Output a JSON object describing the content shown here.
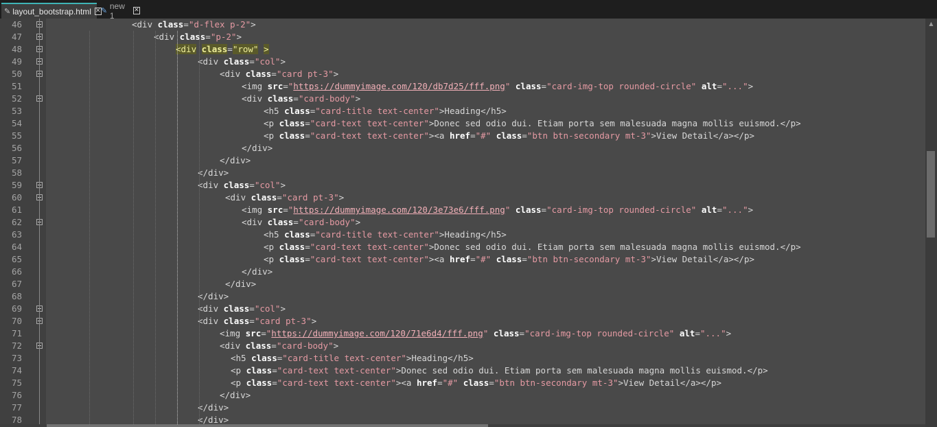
{
  "tabs": [
    {
      "label": "layout_bootstrap.html",
      "active": true,
      "icon": "pencil-icon"
    },
    {
      "label": "new 1",
      "active": false,
      "icon": "pencil-icon"
    }
  ],
  "colors": {
    "tab_accent": "#3fb4b6",
    "attr_value": "#e59aa3",
    "attr_name": "#ffffff",
    "tag": "#d8d8d8",
    "bracket_highlight": "#5a5a2a"
  },
  "lines": [
    {
      "n": "46",
      "fold": true,
      "indent": 8,
      "tokens": [
        [
          "t",
          "<div "
        ],
        [
          "a",
          "class"
        ],
        [
          "e",
          "="
        ],
        [
          "v",
          "\"d-flex p-2\""
        ],
        [
          "t",
          ">"
        ]
      ]
    },
    {
      "n": "47",
      "fold": true,
      "indent": 12,
      "tokens": [
        [
          "t",
          "<div "
        ],
        [
          "a",
          "class"
        ],
        [
          "e",
          "="
        ],
        [
          "v",
          "\"p-2\""
        ],
        [
          "t",
          ">"
        ]
      ]
    },
    {
      "n": "48",
      "fold": true,
      "indent": 16,
      "tokens": [
        [
          "h",
          "<div"
        ],
        [
          "t",
          " "
        ],
        [
          "ah",
          "class"
        ],
        [
          "e",
          "="
        ],
        [
          "vh",
          "\"row\""
        ],
        [
          "t",
          " "
        ],
        [
          "h",
          ">"
        ]
      ]
    },
    {
      "n": "49",
      "fold": true,
      "indent": 20,
      "tokens": [
        [
          "t",
          "<div "
        ],
        [
          "a",
          "class"
        ],
        [
          "e",
          "="
        ],
        [
          "v",
          "\"col\""
        ],
        [
          "t",
          ">"
        ]
      ]
    },
    {
      "n": "50",
      "fold": true,
      "indent": 24,
      "tokens": [
        [
          "t",
          "<div "
        ],
        [
          "a",
          "class"
        ],
        [
          "e",
          "="
        ],
        [
          "v",
          "\"card pt-3\""
        ],
        [
          "t",
          ">"
        ]
      ]
    },
    {
      "n": "51",
      "fold": false,
      "indent": 28,
      "tokens": [
        [
          "t",
          "<img "
        ],
        [
          "a",
          "src"
        ],
        [
          "e",
          "="
        ],
        [
          "v",
          "\""
        ],
        [
          "u",
          "https://dummyimage.com/120/db7d25/fff.png"
        ],
        [
          "v",
          "\""
        ],
        [
          "t",
          " "
        ],
        [
          "a",
          "class"
        ],
        [
          "e",
          "="
        ],
        [
          "v",
          "\"card-img-top rounded-circle\""
        ],
        [
          "t",
          " "
        ],
        [
          "a",
          "alt"
        ],
        [
          "e",
          "="
        ],
        [
          "v",
          "\"...\""
        ],
        [
          "t",
          ">"
        ]
      ]
    },
    {
      "n": "52",
      "fold": true,
      "indent": 28,
      "tokens": [
        [
          "t",
          "<div "
        ],
        [
          "a",
          "class"
        ],
        [
          "e",
          "="
        ],
        [
          "v",
          "\"card-body\""
        ],
        [
          "t",
          ">"
        ]
      ]
    },
    {
      "n": "53",
      "fold": false,
      "indent": 32,
      "tokens": [
        [
          "t",
          "<h5 "
        ],
        [
          "a",
          "class"
        ],
        [
          "e",
          "="
        ],
        [
          "v",
          "\"card-title text-center\""
        ],
        [
          "t",
          ">Heading</h5>"
        ]
      ]
    },
    {
      "n": "54",
      "fold": false,
      "indent": 32,
      "tokens": [
        [
          "t",
          "<p "
        ],
        [
          "a",
          "class"
        ],
        [
          "e",
          "="
        ],
        [
          "v",
          "\"card-text text-center\""
        ],
        [
          "t",
          ">Donec sed odio dui. Etiam porta sem malesuada magna mollis euismod.</p>"
        ]
      ]
    },
    {
      "n": "55",
      "fold": false,
      "indent": 32,
      "tokens": [
        [
          "t",
          "<p "
        ],
        [
          "a",
          "class"
        ],
        [
          "e",
          "="
        ],
        [
          "v",
          "\"card-text text-center\""
        ],
        [
          "t",
          "><a "
        ],
        [
          "a",
          "href"
        ],
        [
          "e",
          "="
        ],
        [
          "v",
          "\"#\""
        ],
        [
          "t",
          " "
        ],
        [
          "a",
          "class"
        ],
        [
          "e",
          "="
        ],
        [
          "v",
          "\"btn btn-secondary mt-3\""
        ],
        [
          "t",
          ">View Detail</a></p>"
        ]
      ]
    },
    {
      "n": "56",
      "fold": false,
      "indent": 28,
      "tokens": [
        [
          "t",
          "</div>"
        ]
      ]
    },
    {
      "n": "57",
      "fold": false,
      "indent": 24,
      "tokens": [
        [
          "t",
          "</div>"
        ]
      ]
    },
    {
      "n": "58",
      "fold": false,
      "indent": 20,
      "tokens": [
        [
          "t",
          "</div>"
        ]
      ]
    },
    {
      "n": "59",
      "fold": true,
      "indent": 20,
      "tokens": [
        [
          "t",
          "<div "
        ],
        [
          "a",
          "class"
        ],
        [
          "e",
          "="
        ],
        [
          "v",
          "\"col\""
        ],
        [
          "t",
          ">"
        ]
      ]
    },
    {
      "n": "60",
      "fold": true,
      "indent": 25,
      "tokens": [
        [
          "t",
          "<div "
        ],
        [
          "a",
          "class"
        ],
        [
          "e",
          "="
        ],
        [
          "v",
          "\"card pt-3\""
        ],
        [
          "t",
          ">"
        ]
      ]
    },
    {
      "n": "61",
      "fold": false,
      "indent": 28,
      "tokens": [
        [
          "t",
          "<img "
        ],
        [
          "a",
          "src"
        ],
        [
          "e",
          "="
        ],
        [
          "v",
          "\""
        ],
        [
          "u",
          "https://dummyimage.com/120/3e73e6/fff.png"
        ],
        [
          "v",
          "\""
        ],
        [
          "t",
          " "
        ],
        [
          "a",
          "class"
        ],
        [
          "e",
          "="
        ],
        [
          "v",
          "\"card-img-top rounded-circle\""
        ],
        [
          "t",
          " "
        ],
        [
          "a",
          "alt"
        ],
        [
          "e",
          "="
        ],
        [
          "v",
          "\"...\""
        ],
        [
          "t",
          ">"
        ]
      ]
    },
    {
      "n": "62",
      "fold": true,
      "indent": 28,
      "tokens": [
        [
          "t",
          "<div "
        ],
        [
          "a",
          "class"
        ],
        [
          "e",
          "="
        ],
        [
          "v",
          "\"card-body\""
        ],
        [
          "t",
          ">"
        ]
      ]
    },
    {
      "n": "63",
      "fold": false,
      "indent": 32,
      "tokens": [
        [
          "t",
          "<h5 "
        ],
        [
          "a",
          "class"
        ],
        [
          "e",
          "="
        ],
        [
          "v",
          "\"card-title text-center\""
        ],
        [
          "t",
          ">Heading</h5>"
        ]
      ]
    },
    {
      "n": "64",
      "fold": false,
      "indent": 32,
      "tokens": [
        [
          "t",
          "<p "
        ],
        [
          "a",
          "class"
        ],
        [
          "e",
          "="
        ],
        [
          "v",
          "\"card-text text-center\""
        ],
        [
          "t",
          ">Donec sed odio dui. Etiam porta sem malesuada magna mollis euismod.</p>"
        ]
      ]
    },
    {
      "n": "65",
      "fold": false,
      "indent": 32,
      "tokens": [
        [
          "t",
          "<p "
        ],
        [
          "a",
          "class"
        ],
        [
          "e",
          "="
        ],
        [
          "v",
          "\"card-text text-center\""
        ],
        [
          "t",
          "><a "
        ],
        [
          "a",
          "href"
        ],
        [
          "e",
          "="
        ],
        [
          "v",
          "\"#\""
        ],
        [
          "t",
          " "
        ],
        [
          "a",
          "class"
        ],
        [
          "e",
          "="
        ],
        [
          "v",
          "\"btn btn-secondary mt-3\""
        ],
        [
          "t",
          ">View Detail</a></p>"
        ]
      ]
    },
    {
      "n": "66",
      "fold": false,
      "indent": 28,
      "tokens": [
        [
          "t",
          "</div>"
        ]
      ]
    },
    {
      "n": "67",
      "fold": false,
      "indent": 25,
      "tokens": [
        [
          "t",
          "</div>"
        ]
      ]
    },
    {
      "n": "68",
      "fold": false,
      "indent": 20,
      "tokens": [
        [
          "t",
          "</div>"
        ]
      ]
    },
    {
      "n": "69",
      "fold": true,
      "indent": 20,
      "tokens": [
        [
          "t",
          "<div "
        ],
        [
          "a",
          "class"
        ],
        [
          "e",
          "="
        ],
        [
          "v",
          "\"col\""
        ],
        [
          "t",
          ">"
        ]
      ]
    },
    {
      "n": "70",
      "fold": true,
      "indent": 20,
      "tokens": [
        [
          "t",
          "<div "
        ],
        [
          "a",
          "class"
        ],
        [
          "e",
          "="
        ],
        [
          "v",
          "\"card pt-3\""
        ],
        [
          "t",
          ">"
        ]
      ]
    },
    {
      "n": "71",
      "fold": false,
      "indent": 24,
      "tokens": [
        [
          "t",
          "<img "
        ],
        [
          "a",
          "src"
        ],
        [
          "e",
          "="
        ],
        [
          "v",
          "\""
        ],
        [
          "u",
          "https://dummyimage.com/120/71e6d4/fff.png"
        ],
        [
          "v",
          "\""
        ],
        [
          "t",
          " "
        ],
        [
          "a",
          "class"
        ],
        [
          "e",
          "="
        ],
        [
          "v",
          "\"card-img-top rounded-circle\""
        ],
        [
          "t",
          " "
        ],
        [
          "a",
          "alt"
        ],
        [
          "e",
          "="
        ],
        [
          "v",
          "\"...\""
        ],
        [
          "t",
          ">"
        ]
      ]
    },
    {
      "n": "72",
      "fold": true,
      "indent": 24,
      "tokens": [
        [
          "t",
          "<div "
        ],
        [
          "a",
          "class"
        ],
        [
          "e",
          "="
        ],
        [
          "v",
          "\"card-body\""
        ],
        [
          "t",
          ">"
        ]
      ]
    },
    {
      "n": "73",
      "fold": false,
      "indent": 26,
      "tokens": [
        [
          "t",
          "<h5 "
        ],
        [
          "a",
          "class"
        ],
        [
          "e",
          "="
        ],
        [
          "v",
          "\"card-title text-center\""
        ],
        [
          "t",
          ">Heading</h5>"
        ]
      ]
    },
    {
      "n": "74",
      "fold": false,
      "indent": 26,
      "tokens": [
        [
          "t",
          "<p "
        ],
        [
          "a",
          "class"
        ],
        [
          "e",
          "="
        ],
        [
          "v",
          "\"card-text text-center\""
        ],
        [
          "t",
          ">Donec sed odio dui. Etiam porta sem malesuada magna mollis euismod.</p>"
        ]
      ]
    },
    {
      "n": "75",
      "fold": false,
      "indent": 26,
      "tokens": [
        [
          "t",
          "<p "
        ],
        [
          "a",
          "class"
        ],
        [
          "e",
          "="
        ],
        [
          "v",
          "\"card-text text-center\""
        ],
        [
          "t",
          "><a "
        ],
        [
          "a",
          "href"
        ],
        [
          "e",
          "="
        ],
        [
          "v",
          "\"#\""
        ],
        [
          "t",
          " "
        ],
        [
          "a",
          "class"
        ],
        [
          "e",
          "="
        ],
        [
          "v",
          "\"btn btn-secondary mt-3\""
        ],
        [
          "t",
          ">View Detail</a></p>"
        ]
      ]
    },
    {
      "n": "76",
      "fold": false,
      "indent": 24,
      "tokens": [
        [
          "t",
          "</div>"
        ]
      ]
    },
    {
      "n": "77",
      "fold": false,
      "indent": 20,
      "tokens": [
        [
          "t",
          "</div>"
        ]
      ]
    },
    {
      "n": "78",
      "fold": false,
      "indent": 20,
      "tokens": [
        [
          "t",
          "</div>"
        ]
      ]
    }
  ]
}
